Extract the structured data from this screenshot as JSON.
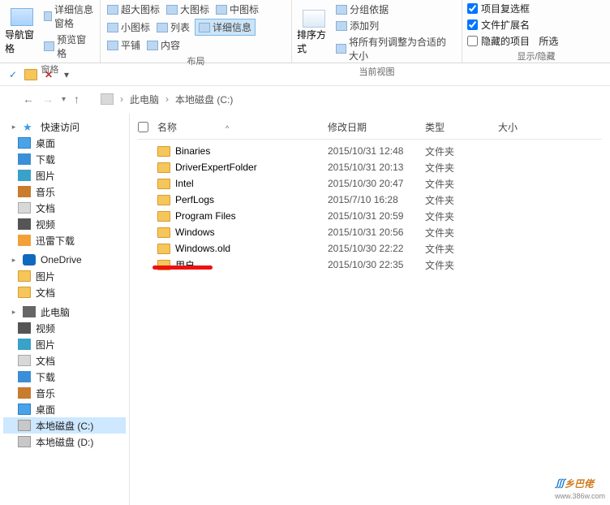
{
  "ribbon": {
    "pane_group": {
      "nav_pane": "导航窗格",
      "preview_pane": "预览窗格",
      "details_pane": "详细信息窗格",
      "label": "窗格"
    },
    "layout_group": {
      "items": [
        "超大图标",
        "大图标",
        "中图标",
        "小图标",
        "列表",
        "详细信息",
        "平铺",
        "内容"
      ],
      "label": "布局"
    },
    "view_group": {
      "sort": "排序方式",
      "group": "分组依据",
      "add_col": "添加列",
      "fit_cols": "将所有列调整为合适的大小",
      "label": "当前视图"
    },
    "showhide_group": {
      "checkboxes": "项目复选框",
      "extensions": "文件扩展名",
      "hidden": "隐藏的项目",
      "selected": "所选",
      "label": "显示/隐藏"
    }
  },
  "addressbar": {
    "check": "✓",
    "x": "✕"
  },
  "breadcrumb": {
    "pc": "此电脑",
    "drive": "本地磁盘 (C:)"
  },
  "sidebar": {
    "quick": "快速访问",
    "desktop": "桌面",
    "downloads": "下载",
    "pictures": "图片",
    "music": "音乐",
    "documents": "文档",
    "videos": "视频",
    "thunder": "迅雷下载",
    "onedrive": "OneDrive",
    "od_pictures": "图片",
    "od_docs": "文档",
    "thispc": "此电脑",
    "pc_videos": "视频",
    "pc_pictures": "图片",
    "pc_docs": "文档",
    "pc_downloads": "下载",
    "pc_music": "音乐",
    "pc_desktop": "桌面",
    "drive_c": "本地磁盘 (C:)",
    "drive_d": "本地磁盘 (D:)"
  },
  "columns": {
    "name": "名称",
    "date": "修改日期",
    "type": "类型",
    "size": "大小"
  },
  "files": [
    {
      "name": "Binaries",
      "date": "2015/10/31 12:48",
      "type": "文件夹"
    },
    {
      "name": "DriverExpertFolder",
      "date": "2015/10/31 20:13",
      "type": "文件夹"
    },
    {
      "name": "Intel",
      "date": "2015/10/30 20:47",
      "type": "文件夹"
    },
    {
      "name": "PerfLogs",
      "date": "2015/7/10 16:28",
      "type": "文件夹"
    },
    {
      "name": "Program Files",
      "date": "2015/10/31 20:59",
      "type": "文件夹"
    },
    {
      "name": "Windows",
      "date": "2015/10/31 20:56",
      "type": "文件夹"
    },
    {
      "name": "Windows.old",
      "date": "2015/10/30 22:22",
      "type": "文件夹"
    },
    {
      "name": "用户",
      "date": "2015/10/30 22:35",
      "type": "文件夹"
    }
  ],
  "watermark": {
    "text": "乡巴佬",
    "url": "www.386w.com"
  }
}
